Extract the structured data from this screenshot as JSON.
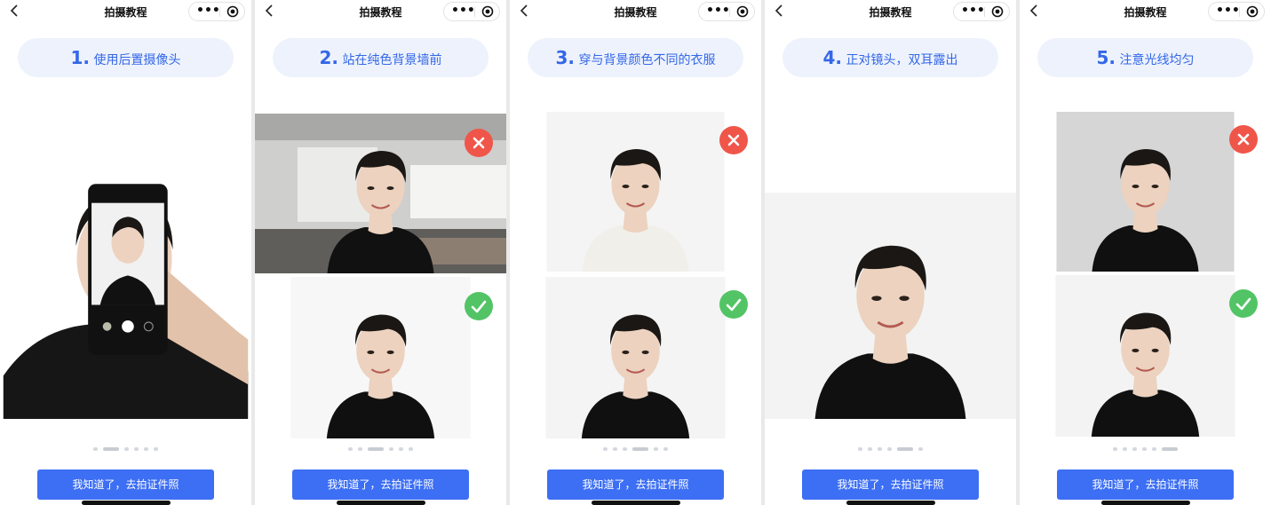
{
  "header": {
    "title": "拍摄教程",
    "more": "•••"
  },
  "steps": [
    {
      "num": "1.",
      "text": "使用后置摄像头"
    },
    {
      "num": "2.",
      "text": "站在纯色背景墙前"
    },
    {
      "num": "3.",
      "text": "穿与背景颜色不同的衣服"
    },
    {
      "num": "4.",
      "text": "正对镜头，双耳露出"
    },
    {
      "num": "5.",
      "text": "注意光线均匀"
    }
  ],
  "confirm_button": "我知道了，去拍证件照",
  "dot_count": 6,
  "colors": {
    "accent": "#3d6ff4",
    "pill_bg": "#edf2fc",
    "pill_text": "#3467e8",
    "error": "#f0554a",
    "ok": "#52c465"
  },
  "icons": {
    "back": "chevron-left-icon",
    "record": "record-icon",
    "wrong": "cross-icon",
    "right": "check-icon"
  },
  "examples": {
    "wrong": "incorrect example",
    "right": "correct example"
  }
}
